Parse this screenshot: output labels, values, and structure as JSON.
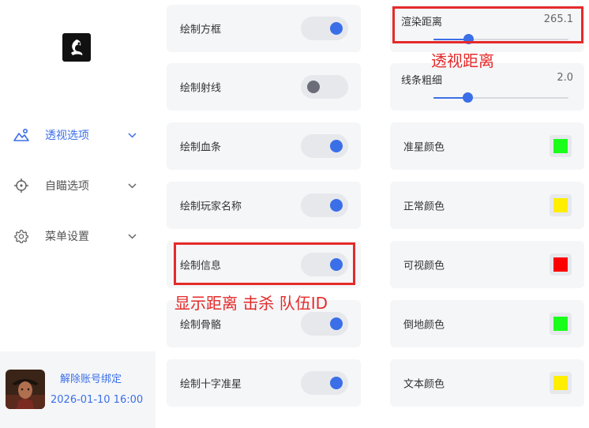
{
  "sidebar": {
    "items": [
      {
        "label": "透视选项",
        "icon": "mountain-sun-icon",
        "active": true
      },
      {
        "label": "自瞄选项",
        "icon": "crosshair-icon",
        "active": false
      },
      {
        "label": "菜单设置",
        "icon": "gear-icon",
        "active": false
      }
    ],
    "account": {
      "unbind_label": "解除账号绑定",
      "expiry": "2026-01-10 16:00"
    }
  },
  "toggles": [
    {
      "label": "绘制方框",
      "on": true
    },
    {
      "label": "绘制射线",
      "on": false
    },
    {
      "label": "绘制血条",
      "on": true
    },
    {
      "label": "绘制玩家名称",
      "on": true
    },
    {
      "label": "绘制信息",
      "on": true
    },
    {
      "label": "绘制骨骼",
      "on": true
    },
    {
      "label": "绘制十字准星",
      "on": true
    }
  ],
  "sliders": [
    {
      "label": "渲染距离",
      "value": "265.1",
      "fraction": 0.26
    },
    {
      "label": "线条粗细",
      "value": "2.0",
      "fraction": 0.25
    }
  ],
  "colors": [
    {
      "label": "准星颜色",
      "color": "#1aff1a"
    },
    {
      "label": "正常颜色",
      "color": "#ffee00"
    },
    {
      "label": "可视颜色",
      "color": "#ff0000"
    },
    {
      "label": "倒地颜色",
      "color": "#1aff1a"
    },
    {
      "label": "文本颜色",
      "color": "#ffee00"
    }
  ],
  "annotations": {
    "render_distance": "透视距离",
    "info": "显示距离 击杀 队伍ID"
  },
  "accent_color": "#3b6fe8",
  "annotation_color": "#e52a2a"
}
